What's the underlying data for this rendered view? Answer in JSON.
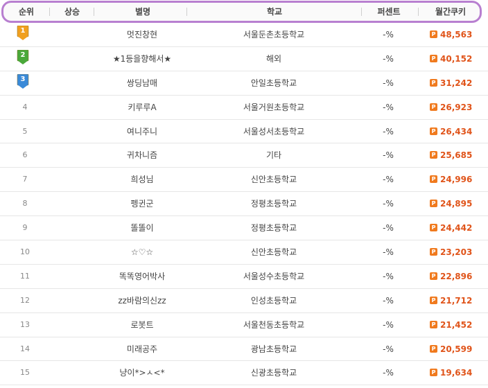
{
  "header": {
    "rank": "순위",
    "rise": "상승",
    "nickname": "별명",
    "school": "학교",
    "percent": "퍼센트",
    "monthly_cookie": "월간쿠키"
  },
  "colors": {
    "header_border": "#b87fd0",
    "cookie_text": "#e0541a",
    "cookie_icon": "#f07a1e",
    "medal_gold": "#f0a020",
    "medal_green": "#4aa83a",
    "medal_blue": "#3a8ad8"
  },
  "cookie_icon_name": "cookie-p-icon",
  "cookie_icon_glyph": "P",
  "rows": [
    {
      "rank": "1",
      "medal": "gold",
      "nickname": "멋진창현",
      "school": "서울둔촌초등학교",
      "percent": "-%",
      "cookies": "48,563"
    },
    {
      "rank": "2",
      "medal": "green",
      "nickname": "★1등을향해서★",
      "school": "해외",
      "percent": "-%",
      "cookies": "40,152"
    },
    {
      "rank": "3",
      "medal": "blue",
      "nickname": "쌍딩남매",
      "school": "안일초등학교",
      "percent": "-%",
      "cookies": "31,242"
    },
    {
      "rank": "4",
      "medal": "",
      "nickname": "키루루A",
      "school": "서울거원초등학교",
      "percent": "-%",
      "cookies": "26,923"
    },
    {
      "rank": "5",
      "medal": "",
      "nickname": "여니주니",
      "school": "서울성서초등학교",
      "percent": "-%",
      "cookies": "26,434"
    },
    {
      "rank": "6",
      "medal": "",
      "nickname": "귀차니즘",
      "school": "기타",
      "percent": "-%",
      "cookies": "25,685"
    },
    {
      "rank": "7",
      "medal": "",
      "nickname": "희성님",
      "school": "신안초등학교",
      "percent": "-%",
      "cookies": "24,996"
    },
    {
      "rank": "8",
      "medal": "",
      "nickname": "펭귄군",
      "school": "정평초등학교",
      "percent": "-%",
      "cookies": "24,895"
    },
    {
      "rank": "9",
      "medal": "",
      "nickname": "똘똘이",
      "school": "정평초등학교",
      "percent": "-%",
      "cookies": "24,442"
    },
    {
      "rank": "10",
      "medal": "",
      "nickname": "☆♡☆",
      "school": "신안초등학교",
      "percent": "-%",
      "cookies": "23,203"
    },
    {
      "rank": "11",
      "medal": "",
      "nickname": "똑똑영어박사",
      "school": "서울성수초등학교",
      "percent": "-%",
      "cookies": "22,896"
    },
    {
      "rank": "12",
      "medal": "",
      "nickname": "zz바람의신zz",
      "school": "인성초등학교",
      "percent": "-%",
      "cookies": "21,712"
    },
    {
      "rank": "13",
      "medal": "",
      "nickname": "로봇트",
      "school": "서울천동초등학교",
      "percent": "-%",
      "cookies": "21,452"
    },
    {
      "rank": "14",
      "medal": "",
      "nickname": "미래공주",
      "school": "광남초등학교",
      "percent": "-%",
      "cookies": "20,599"
    },
    {
      "rank": "15",
      "medal": "",
      "nickname": "냥이*>ㅅ<*",
      "school": "신광초등학교",
      "percent": "-%",
      "cookies": "19,634"
    }
  ]
}
